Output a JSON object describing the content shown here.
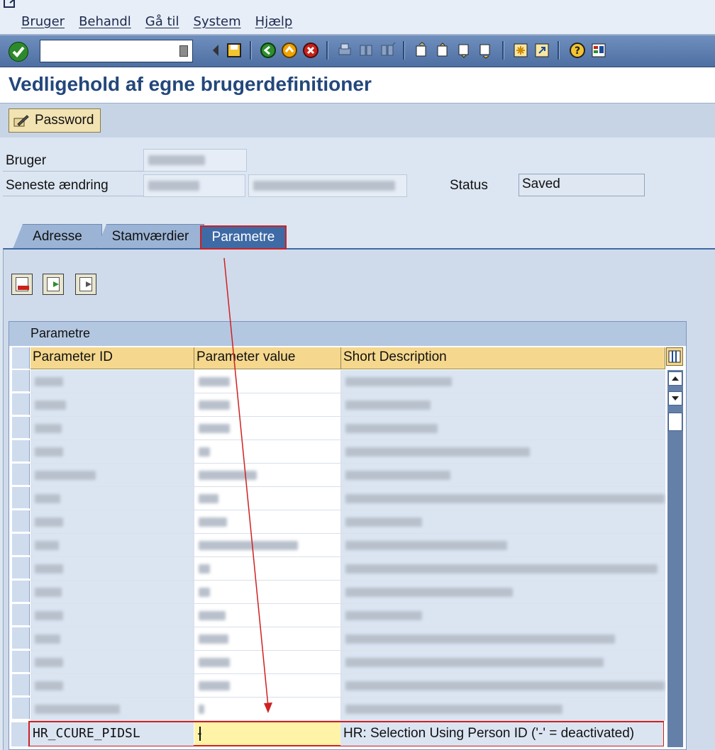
{
  "menubar": {
    "items": [
      "Bruger",
      "Behandl",
      "Gå til",
      "System",
      "Hjælp"
    ]
  },
  "toolbar": {
    "command_field_value": "",
    "buttons": [
      "ok-icon",
      "back-icon",
      "save-icon",
      "back-nav-icon",
      "exit-icon",
      "cancel-icon",
      "print-icon",
      "find-icon",
      "find-next-icon",
      "first-page-icon",
      "prev-page-icon",
      "next-page-icon",
      "last-page-icon",
      "new-session-icon",
      "shortcut-icon",
      "help-icon",
      "customize-icon"
    ]
  },
  "title": "Vedligehold af egne brugerdefinitioner",
  "app_toolbar": {
    "password_label": "Password"
  },
  "header": {
    "bruger_label": "Bruger",
    "seneste_label": "Seneste ændring",
    "status_label": "Status",
    "status_value": "Saved"
  },
  "tabs": [
    {
      "label": "Adresse",
      "active": false
    },
    {
      "label": "Stamværdier",
      "active": false
    },
    {
      "label": "Parametre",
      "active": true
    }
  ],
  "grid": {
    "title": "Parametre",
    "columns": [
      "Parameter ID",
      "Parameter value",
      "Short Description"
    ],
    "last_row": {
      "id": "HR_CCURE_PIDSL",
      "value": "-",
      "description": "HR: Selection Using Person ID ('-' = deactivated)"
    }
  },
  "colors": {
    "title": "#23477b",
    "highlight": "#d02020",
    "header_row": "#f5d88e",
    "input_active": "#fff3a8"
  }
}
